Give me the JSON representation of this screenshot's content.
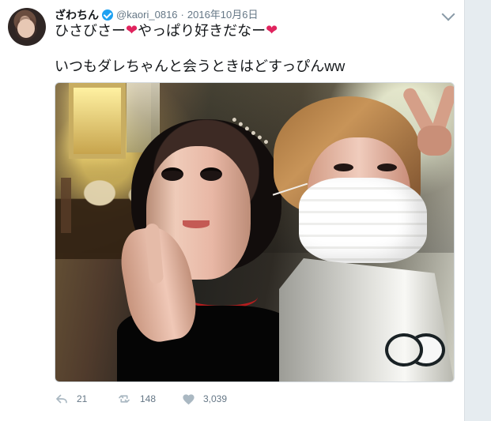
{
  "tweet": {
    "author": {
      "display_name": "ざわちん",
      "handle": "@kaori_0816",
      "verified": true
    },
    "timestamp": "2016年10月6日",
    "text_line_1_before": "ひさびさー",
    "text_line_1_middle": "やっぱり好きだなー",
    "text_line_2": "いつもダレちゃんと会うときはどすっぴんww",
    "emoji": {
      "heart": "❤"
    },
    "media": {
      "type": "photo",
      "description_visible": "two people taking a selfie in a restaurant"
    },
    "actions": {
      "reply_count": "21",
      "retweet_count": "148",
      "like_count": "3,039"
    }
  },
  "colors": {
    "background": "#e6ecf0",
    "card": "#ffffff",
    "text": "#14171a",
    "secondary_text": "#657786",
    "verified_blue": "#1da1f2",
    "heart_red": "#e0245e",
    "action_icon_gray": "#aab8c2"
  },
  "icons": {
    "verified": "verified-icon",
    "menu": "chevron-down-icon",
    "reply": "reply-icon",
    "retweet": "retweet-icon",
    "like": "heart-icon"
  }
}
